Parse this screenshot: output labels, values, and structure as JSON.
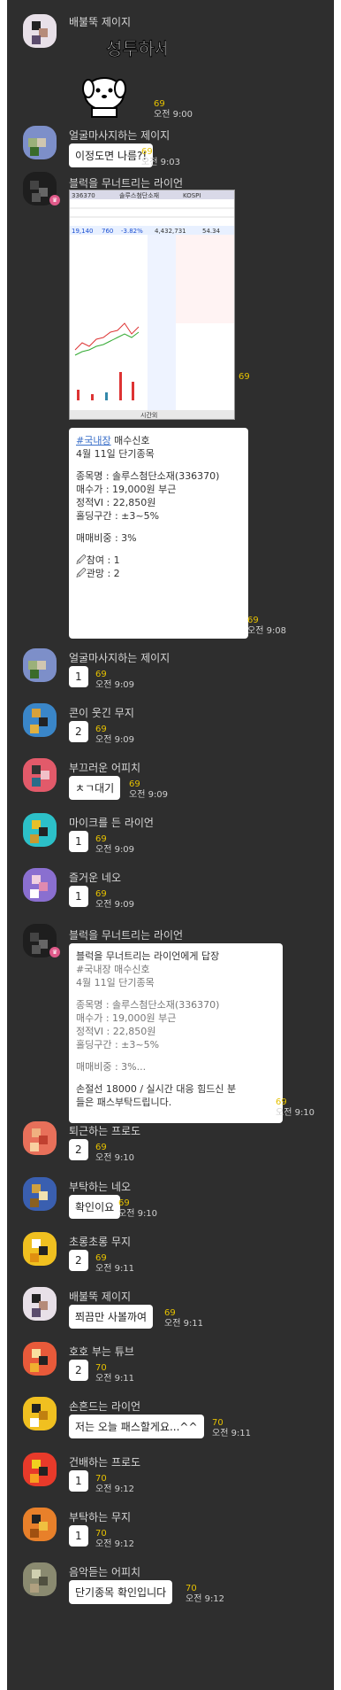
{
  "chat": {
    "messages": [
      {
        "sender": "배불뚝 제이지",
        "sticker_text": "성투하세요",
        "count": "69",
        "time": "오전 9:00"
      },
      {
        "sender": "얼굴마사지하는 제이지",
        "text": "이정도면 나름?!",
        "count": "69",
        "time": "오전 9:03"
      },
      {
        "sender": "블럭을 무너트리는 라이언",
        "count": "69",
        "stock_screen": {
          "code": "336370",
          "name": "솔루스첨단소재",
          "market": "KOSPI",
          "price": "19,140",
          "change": "760",
          "rate": "-3.82%",
          "volume": "4,432,731",
          "ratio": "54.34",
          "time_label": "시간외"
        }
      },
      {
        "sender": "블럭을 무너트리는 라이언",
        "count": "69",
        "time": "오전 9:08",
        "signal": {
          "hashtag": "#국내장",
          "title_suffix": " 매수신호",
          "date_line": "4월 11일 단기종목",
          "stock_line": "종목명 : 솔루스첨단소재(336370)",
          "buy_line": "매수가 : 19,000원 부근",
          "vi_line": "정적VI : 22,850원",
          "band_line": "홀딩구간 : ±3~5%",
          "weight_line": "매매비중 : 3%",
          "join_line": "🖉참여 : 1",
          "watch_line": "🖉관망 : 2"
        }
      },
      {
        "sender": "얼굴마사지하는 제이지",
        "text": "1",
        "count": "69",
        "time": "오전 9:09"
      },
      {
        "sender": "콘이 웃긴 무지",
        "text": "2",
        "count": "69",
        "time": "오전 9:09"
      },
      {
        "sender": "부끄러운 어피치",
        "text": "ㅊㄱ대기",
        "count": "69",
        "time": "오전 9:09"
      },
      {
        "sender": "마이크를 든 라이언",
        "text": "1",
        "count": "69",
        "time": "오전 9:09"
      },
      {
        "sender": "즐거운 네오",
        "text": "1",
        "count": "69",
        "time": "오전 9:09"
      },
      {
        "sender": "블럭을 무너트리는 라이언",
        "count": "69",
        "time": "오전 9:10",
        "reply": {
          "header": "블럭을 무너트리는 라이언에게 답장",
          "hashtag_line": "#국내장 매수신호",
          "date_line": "4월 11일 단기종목",
          "stock_line": "종목명 : 솔루스첨단소재(336370)",
          "buy_line": "매수가 : 19,000원 부근",
          "vi_line": "정적VI : 22,850원",
          "band_line": "홀딩구간 : ±3~5%",
          "weight_line": "매매비중 : 3%...",
          "body_line1": "손절선 18000 / 실시간 대응 힘드신 분",
          "body_line2": "들은 패스부탁드립니다."
        }
      },
      {
        "sender": "퇴근하는 프로도",
        "text": "2",
        "count": "69",
        "time": "오전 9:10"
      },
      {
        "sender": "부탁하는 네오",
        "text": "확인이요",
        "count": "69",
        "time": "오전 9:10"
      },
      {
        "sender": "초롱초롱 무지",
        "text": "2",
        "count": "69",
        "time": "오전 9:11"
      },
      {
        "sender": "배불뚝 제이지",
        "text": "쬐끔만 사볼까여",
        "count": "69",
        "time": "오전 9:11"
      },
      {
        "sender": "호호 부는 튜브",
        "text": "2",
        "count": "70",
        "time": "오전 9:11"
      },
      {
        "sender": "손흔드는 라이언",
        "text": "저는 오늘 패스할게요...^^",
        "count": "70",
        "time": "오전 9:11"
      },
      {
        "sender": "건배하는 프로도",
        "text": "1",
        "count": "70",
        "time": "오전 9:12"
      },
      {
        "sender": "부탁하는 무지",
        "text": "1",
        "count": "70",
        "time": "오전 9:12"
      },
      {
        "sender": "음악듣는 어피치",
        "text": "단기종목 확인입니다",
        "count": "70",
        "time": "오전 9:12"
      }
    ]
  }
}
